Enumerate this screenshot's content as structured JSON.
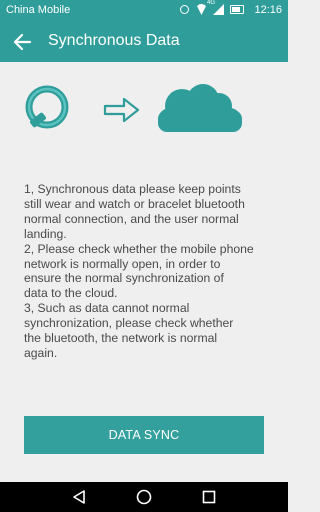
{
  "status_bar": {
    "carrier": "China Mobile",
    "network_label": "4G",
    "time": "12:16"
  },
  "app_bar": {
    "title": "Synchronous Data"
  },
  "illustration": {
    "left_icon": "bracelet-icon",
    "middle_icon": "arrow-right-icon",
    "right_icon": "cloud-icon"
  },
  "instructions": {
    "lines": [
      "1, Synchronous data please keep points",
      "still wear and watch or bracelet bluetooth",
      "normal connection, and the user normal",
      "landing.",
      "2, Please check whether the mobile phone",
      "network is normally open, in order to",
      "ensure the normal synchronization of",
      "data to the cloud.",
      "3, Such as data cannot normal",
      "synchronization, please check whether",
      "the bluetooth, the network is normal",
      "again."
    ]
  },
  "actions": {
    "sync_button_label": "DATA SYNC"
  },
  "colors": {
    "primary": "#2f9e9b",
    "button": "#33a09d",
    "background": "#efefef",
    "text": "#4a4a4a"
  }
}
